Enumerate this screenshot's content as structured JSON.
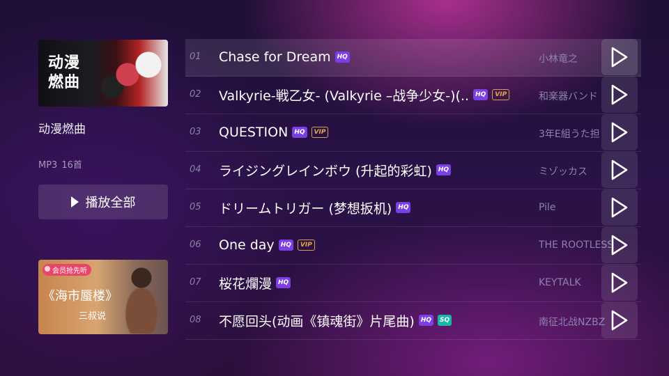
{
  "playlist": {
    "cover_title": "动漫燃曲",
    "name": "动漫燃曲",
    "format": "MP3",
    "count": "16首",
    "play_all_label": "播放全部"
  },
  "ad": {
    "badge": "会员抢先听",
    "title": "《海市蜃楼》",
    "subtitle": "三叔说"
  },
  "songs": [
    {
      "num": "01",
      "title": "Chase for Dream",
      "tags": [
        "HQ"
      ],
      "artist": "小林竜之"
    },
    {
      "num": "02",
      "title": "Valkyrie-戦乙女- (Valkyrie –战争少女-)(..",
      "tags": [
        "HQ",
        "VIP"
      ],
      "artist": "和楽器バンド"
    },
    {
      "num": "03",
      "title": "QUESTION",
      "tags": [
        "HQ",
        "VIP"
      ],
      "artist": "3年E組うた担"
    },
    {
      "num": "04",
      "title": "ライジングレインボウ (升起的彩虹)",
      "tags": [
        "HQ"
      ],
      "artist": "ミゾッカス"
    },
    {
      "num": "05",
      "title": "ドリームトリガー (梦想扳机)",
      "tags": [
        "HQ"
      ],
      "artist": "Pile"
    },
    {
      "num": "06",
      "title": "One day",
      "tags": [
        "HQ",
        "VIP"
      ],
      "artist": "THE ROOTLESS"
    },
    {
      "num": "07",
      "title": "桜花爛漫",
      "tags": [
        "HQ"
      ],
      "artist": "KEYTALK"
    },
    {
      "num": "08",
      "title": "不愿回头(动画《镇魂街》片尾曲)",
      "tags": [
        "HQ",
        "SQ"
      ],
      "artist": "南征北战NZBZ"
    }
  ],
  "focused_index": 0,
  "icons": {
    "play": "play-icon"
  },
  "colors": {
    "hq": "#7b3fe4",
    "sq": "#19b7a7",
    "vip": "#e2a84e"
  }
}
